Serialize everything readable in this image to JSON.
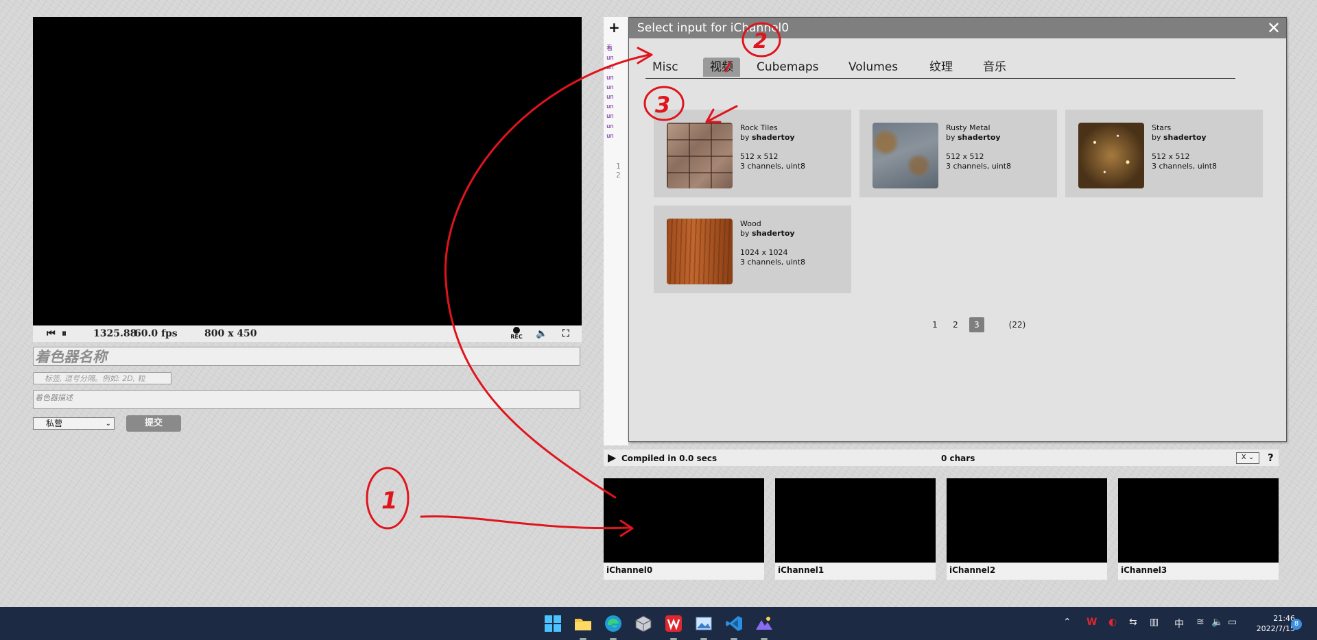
{
  "player": {
    "time": "1325.88",
    "fps": "60.0 fps",
    "resolution": "800 x 450",
    "rec_label": "REC"
  },
  "form": {
    "name_placeholder": "着色器名称",
    "tags_placeholder": "标签, 逗号分隔。例如: 2D, 粒",
    "desc_placeholder": "着色器描述",
    "privacy_value": "私营",
    "submit_label": "提交"
  },
  "editor": {
    "code_lines": [
      "看",
      "un",
      "un",
      "un",
      "un",
      "un",
      "un",
      "un",
      "un",
      "un"
    ],
    "line_numbers": [
      "1",
      "2"
    ],
    "compiled": "Compiled in 0.0 secs",
    "chars": "0 chars",
    "x_select": "X",
    "help": "?"
  },
  "channels": [
    "iChannel0",
    "iChannel1",
    "iChannel2",
    "iChannel3"
  ],
  "dialog": {
    "title": "Select input for iChannel0",
    "tabs": [
      "Misc",
      "视频",
      "Cubemaps",
      "Volumes",
      "纹理",
      "音乐"
    ],
    "active_tab": "视频",
    "items": [
      {
        "name": "Rock Tiles",
        "by": "by",
        "author": "shadertoy",
        "size": "512 x 512",
        "format": "3 channels, uint8",
        "thumb": "rock-tiles"
      },
      {
        "name": "Rusty Metal",
        "by": "by",
        "author": "shadertoy",
        "size": "512 x 512",
        "format": "3 channels, uint8",
        "thumb": "rusty-metal"
      },
      {
        "name": "Stars",
        "by": "by",
        "author": "shadertoy",
        "size": "512 x 512",
        "format": "3 channels, uint8",
        "thumb": "stars"
      },
      {
        "name": "Wood",
        "by": "by",
        "author": "shadertoy",
        "size": "1024 x 1024",
        "format": "3 channels, uint8",
        "thumb": "wood"
      }
    ],
    "pages": [
      "1",
      "2",
      "3"
    ],
    "current_page": "3",
    "total": "(22)"
  },
  "taskbar": {
    "icons": [
      "windows-start-icon",
      "file-explorer-icon",
      "edge-browser-icon",
      "app-cube-icon",
      "wps-office-icon",
      "image-viewer-icon",
      "vscode-icon",
      "app-mountain-icon"
    ],
    "tray": {
      "ime": "中"
    },
    "time": "21:46",
    "date": "2022/7/15",
    "notifications": "8"
  },
  "annotations": {
    "marks": [
      "1",
      "2",
      "3"
    ],
    "color": "#e0141c"
  }
}
